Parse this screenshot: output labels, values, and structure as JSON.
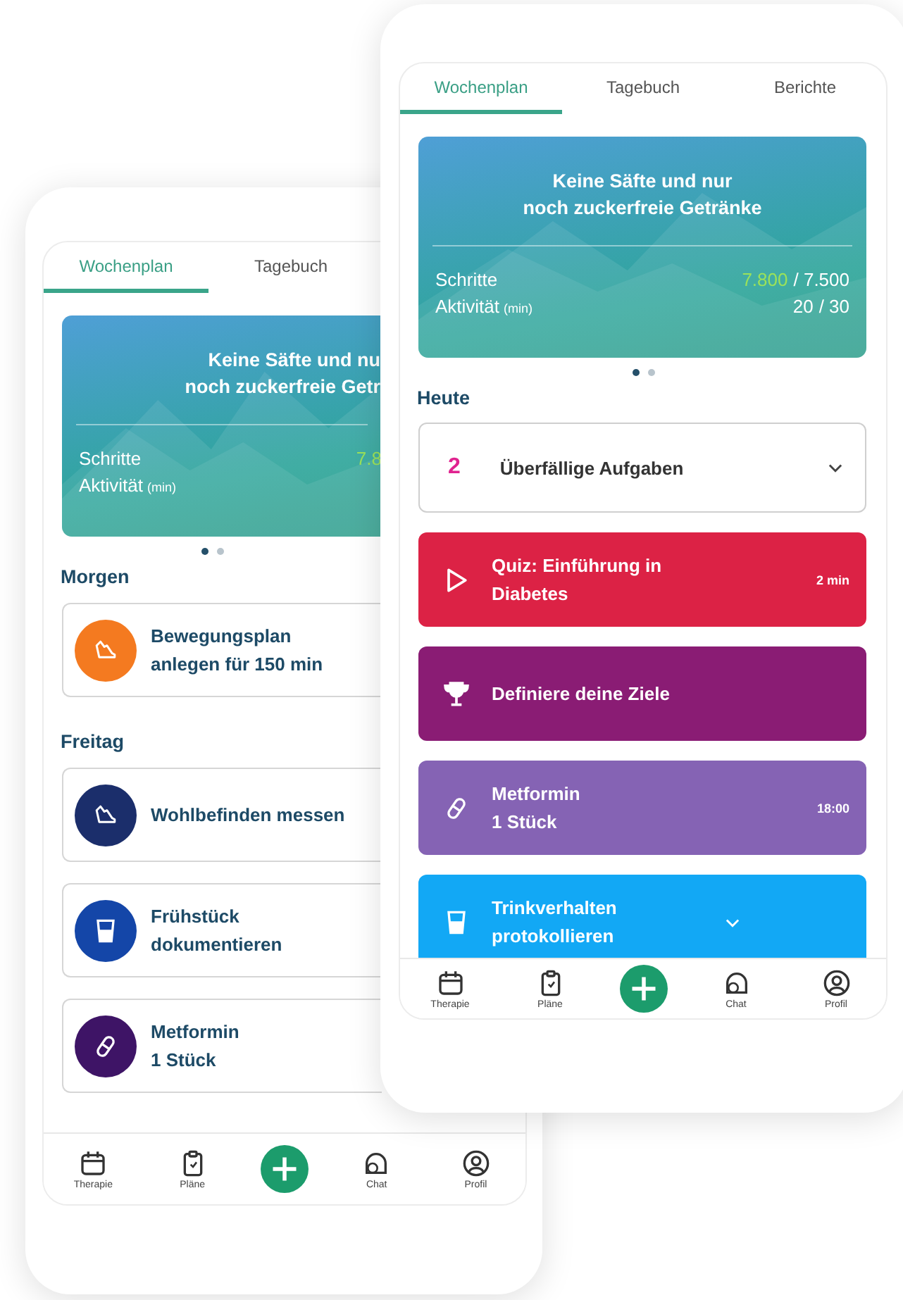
{
  "phones": [
    {
      "tabs": [
        {
          "label": "Wochenplan",
          "selected": true
        },
        {
          "label": "Tagebuch",
          "selected": false
        }
      ],
      "card": {
        "title": [
          "Keine Säfte und nu",
          "noch zuckerfreie Getr"
        ],
        "stats": [
          {
            "label": "Schritte",
            "value": "7.8",
            "reached": true
          },
          {
            "label": "Aktivität",
            "unit": "(min)"
          }
        ]
      },
      "dots": [
        {
          "selected": true
        },
        {
          "selected": false
        }
      ],
      "sections": [
        {
          "heading": "Morgen",
          "tasks": [
            {
              "title": "Bewegungsplan anlegen für 150 min",
              "kind": "exercise",
              "color": "#f47a20",
              "filled": false
            }
          ]
        },
        {
          "heading": "Freitag",
          "tasks": [
            {
              "title": "Wohlbefinden messen",
              "kind": "exercise",
              "color": "#1b2e6b",
              "filled": false
            },
            {
              "title": "Frühstück dokumentieren",
              "kind": "drink",
              "color": "#1446a8",
              "filled": false
            },
            {
              "title": "Metformin",
              "detail": "1 Stück",
              "kind": "pill",
              "color": "#3e1466",
              "filled": false
            }
          ]
        }
      ],
      "nav": [
        {
          "label": "Therapie",
          "kind": "calendar"
        },
        {
          "label": "Pläne",
          "kind": "clipboard"
        },
        {
          "kind": "add"
        },
        {
          "label": "Chat",
          "kind": "chat"
        },
        {
          "label": "Profil",
          "kind": "profile"
        }
      ]
    },
    {
      "tabs": [
        {
          "label": "Wochenplan",
          "selected": true
        },
        {
          "label": "Tagebuch",
          "selected": false
        },
        {
          "label": "Berichte",
          "selected": false
        }
      ],
      "card": {
        "title": [
          "Keine Säfte und nur",
          "noch zuckerfreie Getränke"
        ],
        "stats": [
          {
            "label": "Schritte",
            "value": "7.800",
            "target": "/ 7.500",
            "reached": true
          },
          {
            "label": "Aktivität",
            "unit": "(min)",
            "value": "20",
            "target": "/ 30",
            "reached": false
          }
        ]
      },
      "dots": [
        {
          "selected": true
        },
        {
          "selected": false
        }
      ],
      "sections": [
        {
          "heading": "Heute",
          "overdue": {
            "count": "2",
            "label": "Überfällige Aufgaben"
          },
          "tasks": [
            {
              "title": "Quiz: Einführung in Diabetes",
              "time": "2 min",
              "kind": "quiz",
              "color": "#dc2245",
              "filled": true
            },
            {
              "title": "Definiere deine Ziele",
              "kind": "goal",
              "color": "#8a1c74",
              "filled": true
            },
            {
              "title": "Metformin",
              "detail": "1 Stück",
              "time": "18:00",
              "kind": "pill",
              "color": "#8563b4",
              "filled": true
            },
            {
              "title": "Trinkverhalten protokollieren",
              "kind": "drink",
              "color": "#12a8f5",
              "filled": true,
              "collapsible": true
            }
          ]
        }
      ],
      "nav": [
        {
          "label": "Therapie",
          "kind": "calendar"
        },
        {
          "label": "Pläne",
          "kind": "clipboard"
        },
        {
          "kind": "add"
        },
        {
          "label": "Chat",
          "kind": "chat"
        },
        {
          "label": "Profil",
          "kind": "profile"
        }
      ]
    }
  ]
}
